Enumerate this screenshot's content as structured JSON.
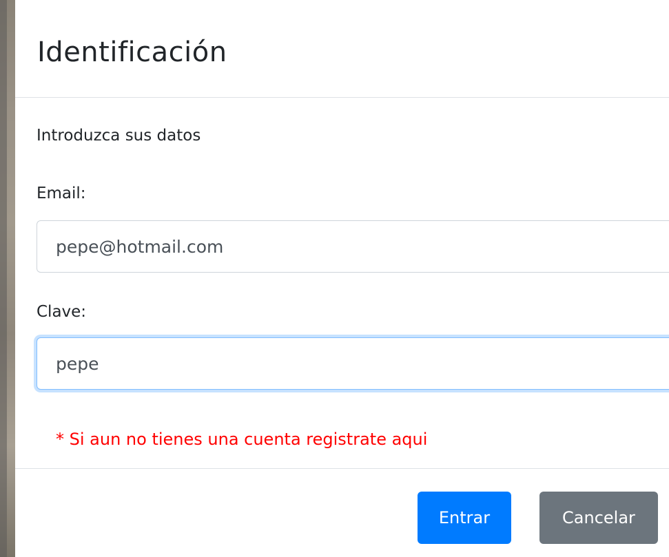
{
  "modal": {
    "title": "Identificación",
    "intro": "Introduzca sus datos",
    "email_label": "Email:",
    "email_value": "pepe@hotmail.com",
    "password_label": "Clave:",
    "password_value": "pepe",
    "register_note": "* Si aun no tienes una cuenta registrate aqui",
    "submit_label": "Entrar",
    "cancel_label": "Cancelar"
  },
  "colors": {
    "primary": "#007bff",
    "secondary": "#6c757d",
    "danger_text": "#ff0000",
    "focus_border": "#80bdff"
  }
}
